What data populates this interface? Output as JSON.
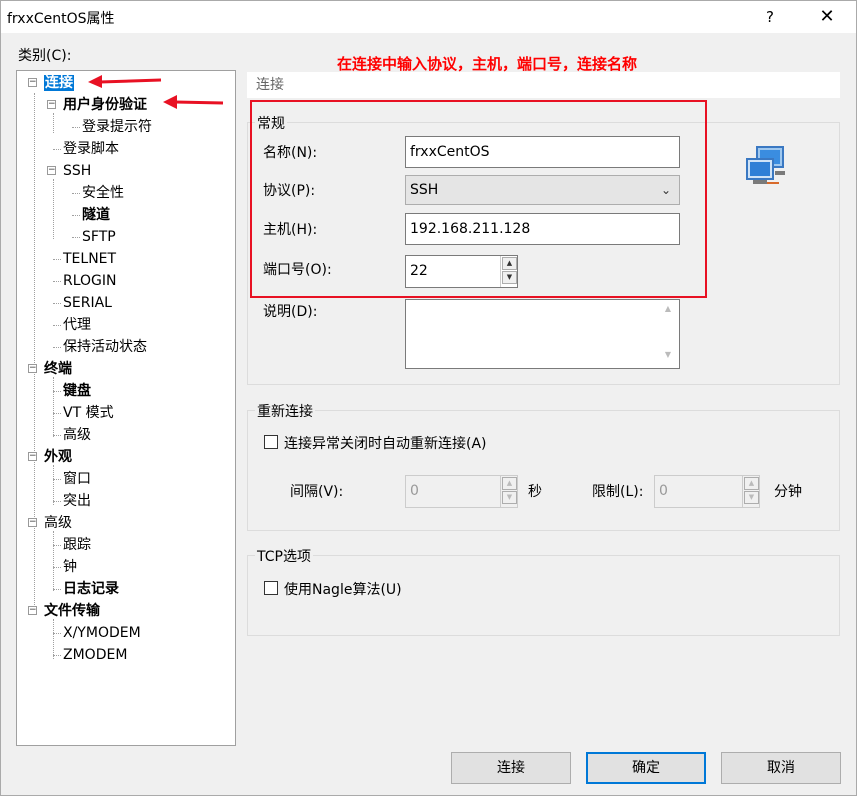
{
  "window": {
    "title": "frxxCentOS属性",
    "help": "?",
    "close": "✕"
  },
  "category_label": "类别(C):",
  "tree": [
    {
      "label": "连接",
      "bold": true,
      "selected": true,
      "expander": "⊟"
    },
    {
      "label": "用户身份验证",
      "bold": true,
      "expander": "⊟"
    },
    {
      "label": "登录提示符"
    },
    {
      "label": "登录脚本"
    },
    {
      "label": "SSH",
      "expander": "⊟"
    },
    {
      "label": "安全性"
    },
    {
      "label": "隧道",
      "bold": true
    },
    {
      "label": "SFTP"
    },
    {
      "label": "TELNET"
    },
    {
      "label": "RLOGIN"
    },
    {
      "label": "SERIAL"
    },
    {
      "label": "代理"
    },
    {
      "label": "保持活动状态"
    },
    {
      "label": "终端",
      "bold": true,
      "expander": "⊟"
    },
    {
      "label": "键盘",
      "bold": true
    },
    {
      "label": "VT 模式"
    },
    {
      "label": "高级"
    },
    {
      "label": "外观",
      "bold": true,
      "expander": "⊟"
    },
    {
      "label": "窗口"
    },
    {
      "label": "突出"
    },
    {
      "label": "高级",
      "expander": "⊟"
    },
    {
      "label": "跟踪"
    },
    {
      "label": "钟"
    },
    {
      "label": "日志记录",
      "bold": true
    },
    {
      "label": "文件传输",
      "bold": true,
      "expander": "⊟"
    },
    {
      "label": "X/YMODEM"
    },
    {
      "label": "ZMODEM"
    }
  ],
  "annotation": "在连接中输入协议，主机，端口号，连接名称",
  "panel_header": "连接",
  "general": {
    "title": "常规",
    "name_label": "名称(N):",
    "name_value": "frxxCentOS",
    "protocol_label": "协议(P):",
    "protocol_value": "SSH",
    "host_label": "主机(H):",
    "host_value": "192.168.211.128",
    "port_label": "端口号(O):",
    "port_value": "22",
    "desc_label": "说明(D):",
    "desc_value": ""
  },
  "reconnect": {
    "title": "重新连接",
    "checkbox_label": "连接异常关闭时自动重新连接(A)",
    "interval_label": "间隔(V):",
    "interval_value": "0",
    "interval_unit": "秒",
    "limit_label": "限制(L):",
    "limit_value": "0",
    "limit_unit": "分钟"
  },
  "tcp": {
    "title": "TCP选项",
    "nagle_label": "使用Nagle算法(U)"
  },
  "buttons": {
    "connect": "连接",
    "ok": "确定",
    "cancel": "取消"
  },
  "colors": {
    "accent": "#0078d7",
    "annotation": "#ff0000"
  }
}
